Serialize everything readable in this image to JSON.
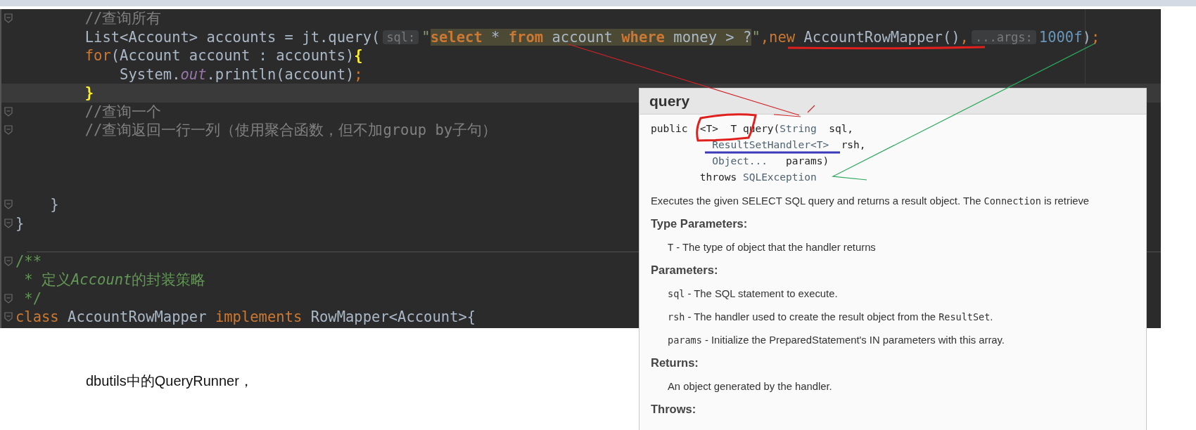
{
  "editor": {
    "lines": [
      {
        "fold": true,
        "current": false,
        "separator_above": false,
        "tokens": [
          {
            "text": "        //查询所有",
            "kind": "comment"
          }
        ]
      },
      {
        "fold": false,
        "current": false,
        "separator_above": false,
        "tokens": [
          {
            "text": "        List<Account> accounts = jt.query(",
            "kind": "plain"
          },
          {
            "text": "sql:",
            "kind": "hint"
          },
          {
            "text": "\"",
            "kind": "string"
          },
          {
            "text": "select",
            "kind": "sql_keyword"
          },
          {
            "text": " * ",
            "kind": "sql_text"
          },
          {
            "text": "from",
            "kind": "sql_keyword"
          },
          {
            "text": " account ",
            "kind": "sql_text"
          },
          {
            "text": "where",
            "kind": "sql_keyword"
          },
          {
            "text": " money > ?",
            "kind": "sql_text"
          },
          {
            "text": "\"",
            "kind": "string"
          },
          {
            "text": ",new",
            "kind": "keyword"
          },
          {
            "text": " AccountRowMapper()",
            "kind": "plain"
          },
          {
            "text": ",",
            "kind": "keyword"
          },
          {
            "text": "...args:",
            "kind": "hint"
          },
          {
            "text": "1000f",
            "kind": "number"
          },
          {
            "text": ")",
            "kind": "plain"
          },
          {
            "text": ";",
            "kind": "keyword"
          }
        ]
      },
      {
        "fold": false,
        "current": false,
        "separator_above": false,
        "tokens": [
          {
            "text": "        for",
            "kind": "keyword"
          },
          {
            "text": "(Account account : accounts)",
            "kind": "plain"
          },
          {
            "text": "{",
            "kind": "brace_match"
          }
        ]
      },
      {
        "fold": false,
        "current": false,
        "separator_above": false,
        "tokens": [
          {
            "text": "            System.",
            "kind": "plain"
          },
          {
            "text": "out",
            "kind": "field"
          },
          {
            "text": ".println(account)",
            "kind": "plain"
          },
          {
            "text": ";",
            "kind": "keyword"
          }
        ]
      },
      {
        "fold": false,
        "current": true,
        "separator_above": false,
        "tokens": [
          {
            "text": "        }",
            "kind": "brace_match"
          }
        ]
      },
      {
        "fold": true,
        "current": false,
        "separator_above": false,
        "tokens": [
          {
            "text": "        //查询一个",
            "kind": "comment"
          }
        ]
      },
      {
        "fold": true,
        "current": false,
        "separator_above": false,
        "tokens": [
          {
            "text": "        //查询返回一行一列（使用聚合函数，但不加group by子句）",
            "kind": "comment"
          }
        ]
      },
      {
        "fold": false,
        "current": false,
        "separator_above": false
      },
      {
        "fold": false,
        "current": false,
        "separator_above": false
      },
      {
        "fold": false,
        "current": false,
        "separator_above": false
      },
      {
        "fold": true,
        "current": false,
        "separator_above": false,
        "tokens": [
          {
            "text": "    }",
            "kind": "plain"
          }
        ]
      },
      {
        "fold": true,
        "current": false,
        "separator_above": false,
        "tokens": [
          {
            "text": "}",
            "kind": "plain"
          }
        ]
      },
      {
        "fold": false,
        "current": false,
        "separator_above": false
      },
      {
        "fold": true,
        "current": false,
        "separator_above": true,
        "tokens": [
          {
            "text": "/**",
            "kind": "doc"
          }
        ]
      },
      {
        "fold": false,
        "current": false,
        "separator_above": false,
        "tokens": [
          {
            "text": " * 定义",
            "kind": "doc"
          },
          {
            "text": "Account",
            "kind": "doc_italic"
          },
          {
            "text": "的封装策略",
            "kind": "doc"
          }
        ]
      },
      {
        "fold": true,
        "current": false,
        "separator_above": false,
        "tokens": [
          {
            "text": " */",
            "kind": "doc"
          }
        ]
      },
      {
        "fold": true,
        "current": false,
        "separator_above": false,
        "tokens": [
          {
            "text": "class",
            "kind": "keyword"
          },
          {
            "text": " AccountRowMapper ",
            "kind": "plain"
          },
          {
            "text": "implements",
            "kind": "keyword"
          },
          {
            "text": " RowMapper<Account>{",
            "kind": "plain"
          }
        ]
      }
    ]
  },
  "doc_popup": {
    "title": "query",
    "signature": [
      {
        "parts": [
          {
            "text": "public  <T>  T query(",
            "kind": "plain"
          },
          {
            "text": "String",
            "kind": "type"
          },
          {
            "text": "  sql,",
            "kind": "plain"
          }
        ]
      },
      {
        "parts": [
          {
            "text": "          ResultSetHandler<T>",
            "kind": "type"
          },
          {
            "text": "  rsh,",
            "kind": "plain"
          }
        ]
      },
      {
        "parts": [
          {
            "text": "          Object...",
            "kind": "type"
          },
          {
            "text": "   params)",
            "kind": "plain"
          }
        ]
      },
      {
        "parts": [
          {
            "text": "        throws ",
            "kind": "plain"
          },
          {
            "text": "SQLException",
            "kind": "type"
          }
        ]
      }
    ],
    "description": [
      {
        "text": "Executes the given SELECT SQL query and returns a result object. The ",
        "code": false
      },
      {
        "text": "Connection",
        "code": true
      },
      {
        "text": " is retrieve",
        "code": false
      }
    ],
    "sections": [
      {
        "heading": "Type Parameters:",
        "items": [
          {
            "parts": [
              {
                "text": "T",
                "code": true
              },
              {
                "text": " - The type of object that the handler returns",
                "code": false
              }
            ]
          }
        ]
      },
      {
        "heading": "Parameters:",
        "items": [
          {
            "parts": [
              {
                "text": "sql",
                "code": true
              },
              {
                "text": " - The SQL statement to execute.",
                "code": false
              }
            ]
          },
          {
            "parts": [
              {
                "text": "rsh",
                "code": true
              },
              {
                "text": " - The handler used to create the result object from the ",
                "code": false
              },
              {
                "text": "ResultSet",
                "code": true
              },
              {
                "text": ".",
                "code": false
              }
            ]
          },
          {
            "parts": [
              {
                "text": "params",
                "code": true
              },
              {
                "text": " - Initialize the PreparedStatement's IN parameters with this array.",
                "code": false
              }
            ]
          }
        ]
      },
      {
        "heading": "Returns:",
        "items": [
          {
            "parts": [
              {
                "text": "An object generated by the handler.",
                "code": false
              }
            ]
          }
        ]
      },
      {
        "heading": "Throws:"
      }
    ]
  },
  "note": "dbutils中的QueryRunner，"
}
